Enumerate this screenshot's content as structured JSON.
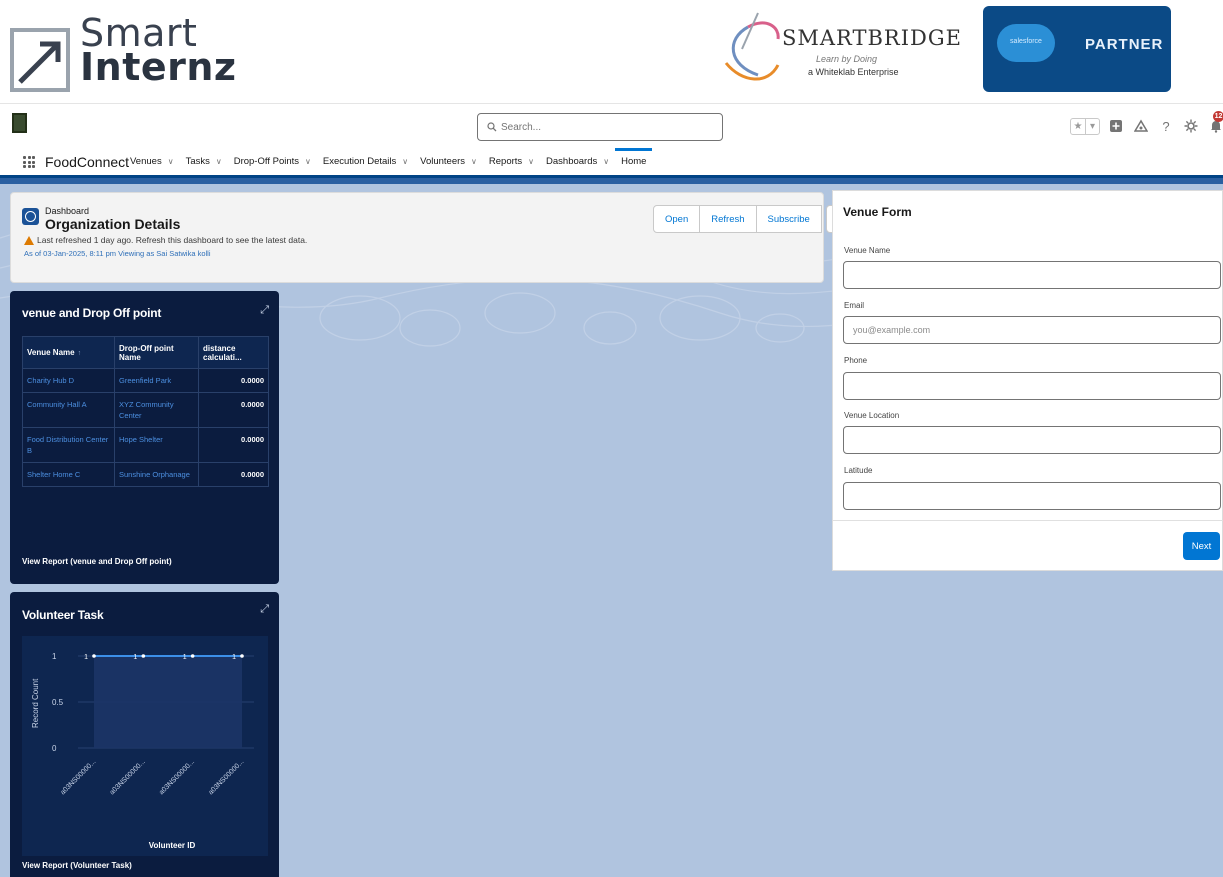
{
  "banner": {
    "smartinternz_line1": "Smart",
    "smartinternz_line2": "Internz",
    "smartbridge_name": "SMARTBRIDGE",
    "smartbridge_tagline": "Learn by Doing",
    "smartbridge_sub": "a Whiteklab Enterprise",
    "partner_cloud": "salesforce",
    "partner_label": "PARTNER"
  },
  "header": {
    "search_placeholder": "Search...",
    "notification_count": "12"
  },
  "nav": {
    "app_name": "FoodConnect",
    "items": [
      {
        "label": "Venues",
        "has_menu": true
      },
      {
        "label": "Tasks",
        "has_menu": true
      },
      {
        "label": "Drop-Off Points",
        "has_menu": true
      },
      {
        "label": "Execution Details",
        "has_menu": true
      },
      {
        "label": "Volunteers",
        "has_menu": true
      },
      {
        "label": "Reports",
        "has_menu": true
      },
      {
        "label": "Dashboards",
        "has_menu": true
      },
      {
        "label": "Home",
        "has_menu": false,
        "active": true
      }
    ]
  },
  "dashboard": {
    "object_label": "Dashboard",
    "title": "Organization Details",
    "warning": "Last refreshed 1 day ago. Refresh this dashboard to see the latest data.",
    "as_of": "As of 03-Jan-2025, 8:11 pm Viewing as Sai Satwika kolli",
    "buttons": {
      "open": "Open",
      "refresh": "Refresh",
      "subscribe": "Subscribe"
    }
  },
  "widget_venue": {
    "title": "venue and Drop Off point",
    "columns": [
      "Venue Name",
      "Drop-Off point Name",
      "distance calculati..."
    ],
    "rows": [
      [
        "Charity Hub D",
        "Greenfield Park",
        "0.0000"
      ],
      [
        "Community Hall A",
        "XYZ Community Center",
        "0.0000"
      ],
      [
        "Food Distribution Center B",
        "Hope Shelter",
        "0.0000"
      ],
      [
        "Shelter Home C",
        "Sunshine Orphanage",
        "0.0000"
      ]
    ],
    "footer": "View Report (venue and Drop Off point)"
  },
  "widget_task": {
    "title": "Volunteer Task",
    "footer": "View Report (Volunteer Task)"
  },
  "chart_data": {
    "type": "line",
    "title": "Volunteer Task",
    "xlabel": "Volunteer ID",
    "ylabel": "Record Count",
    "categories": [
      "a03NS00000...",
      "a03NS00000...",
      "a03NS00000...",
      "a03NS00000..."
    ],
    "series": [
      {
        "values": [
          1,
          1,
          1,
          1
        ]
      }
    ],
    "point_labels": [
      "1",
      "1",
      "1",
      "1"
    ],
    "yticks": [
      "0",
      "0.5",
      "1"
    ],
    "ylim": [
      0,
      1
    ],
    "grid": true,
    "colors": {
      "line": "#3c8fe8",
      "fill": "#1c3566"
    }
  },
  "venue_form": {
    "title": "Venue Form",
    "fields": [
      {
        "label": "Venue Name",
        "value": "",
        "placeholder": ""
      },
      {
        "label": "Email",
        "value": "",
        "placeholder": "you@example.com"
      },
      {
        "label": "Phone",
        "value": "",
        "placeholder": ""
      },
      {
        "label": "Venue Location",
        "value": "",
        "placeholder": ""
      },
      {
        "label": "Latitude",
        "value": "",
        "placeholder": ""
      }
    ],
    "next_label": "Next"
  },
  "colors": {
    "brand_blue": "#0176d3",
    "nav_underline": "#014486",
    "widget_bg": "#0b1c3f",
    "workspace_bg": "#b0c4df",
    "warning": "#dd7a01"
  },
  "icons": [
    "smartinternz-logo",
    "smartbridge-logo",
    "salesforce-partner-badge",
    "org-logo",
    "search-icon",
    "favorites-star-icon",
    "favorites-list-icon",
    "global-actions-icon",
    "trailhead-icon",
    "help-icon",
    "setup-gear-icon",
    "notifications-bell-icon",
    "avatar",
    "app-launcher-icon",
    "dashboard-icon",
    "warning-icon",
    "expand-icon"
  ]
}
